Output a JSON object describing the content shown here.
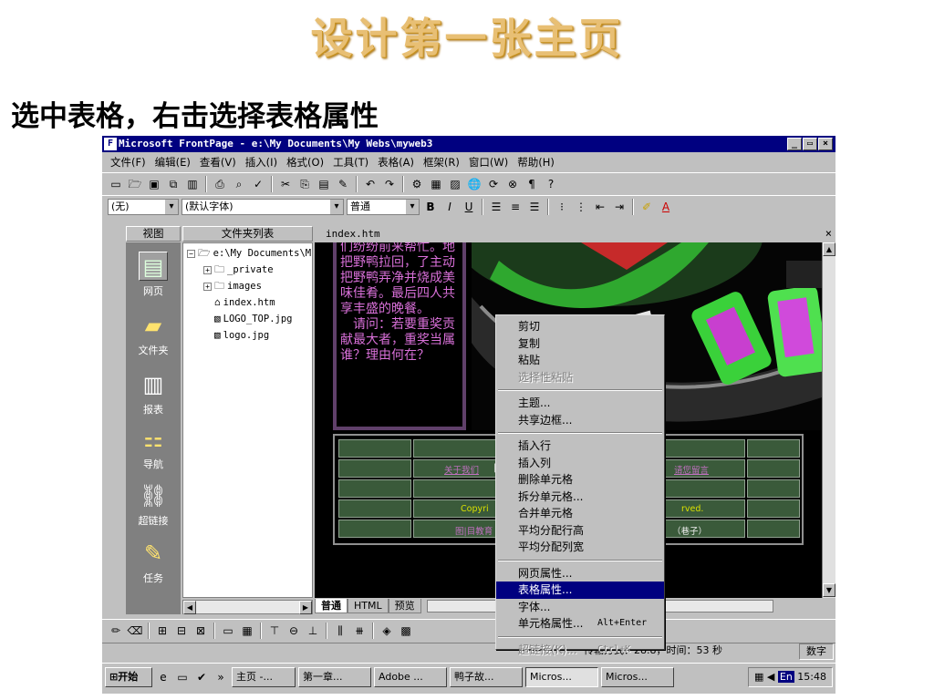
{
  "slide": {
    "title": "设计第一张主页",
    "subtitle": "选中表格，右击选择表格属性"
  },
  "window": {
    "title": "Microsoft FrontPage - e:\\My Documents\\My Webs\\myweb3",
    "controls": [
      "_",
      "▭",
      "×"
    ]
  },
  "menu": [
    "文件(F)",
    "编辑(E)",
    "查看(V)",
    "插入(I)",
    "格式(O)",
    "工具(T)",
    "表格(A)",
    "框架(R)",
    "窗口(W)",
    "帮助(H)"
  ],
  "format_toolbar": {
    "style": "(无)",
    "font": "(默认字体)",
    "size": "普通",
    "bold": "B",
    "italic": "I",
    "underline": "U"
  },
  "views": {
    "header": "视图",
    "items": [
      {
        "label": "网页",
        "icon": "page-icon"
      },
      {
        "label": "文件夹",
        "icon": "folder-icon"
      },
      {
        "label": "报表",
        "icon": "reports-icon"
      },
      {
        "label": "导航",
        "icon": "navigation-icon"
      },
      {
        "label": "超链接",
        "icon": "hyperlinks-icon"
      },
      {
        "label": "任务",
        "icon": "tasks-icon"
      }
    ]
  },
  "folder_list": {
    "header": "文件夹列表",
    "root": "e:\\My Documents\\M",
    "items": [
      "_private",
      "images",
      "index.htm",
      "LOGO_TOP.jpg",
      "logo.jpg"
    ]
  },
  "editor": {
    "tab": "index.htm",
    "close": "×",
    "story_text": "来到小鸟家后，邻居们纷纷前来帮忙。地把野鸭拉回，了主动把野鸭弄净并烧成美味佳肴。最后四人共享丰盛的晚餐。\n　请问：若要重奖贡献最大者，重奖当属谁？理由何在？",
    "nav_links": [
      "关于我们",
      "|",
      "请您留言"
    ],
    "copyright_left": "Copyri",
    "copyright_right": "rved.",
    "footer_left": "图|目教育",
    "footer_right": "（巷子）",
    "view_tabs": [
      "普通",
      "HTML",
      "预览"
    ]
  },
  "context_menu": {
    "items": [
      {
        "label": "剪切",
        "disabled": false
      },
      {
        "label": "复制",
        "disabled": false
      },
      {
        "label": "粘贴",
        "disabled": false
      },
      {
        "label": "选择性粘贴",
        "disabled": true
      },
      {
        "sep": true
      },
      {
        "label": "主题...",
        "disabled": false
      },
      {
        "label": "共享边框...",
        "disabled": false
      },
      {
        "sep": true
      },
      {
        "label": "插入行",
        "disabled": false
      },
      {
        "label": "插入列",
        "disabled": false
      },
      {
        "label": "删除单元格",
        "disabled": false
      },
      {
        "label": "拆分单元格...",
        "disabled": false
      },
      {
        "label": "合并单元格",
        "disabled": false
      },
      {
        "label": "平均分配行高",
        "disabled": false
      },
      {
        "label": "平均分配列宽",
        "disabled": false
      },
      {
        "sep": true
      },
      {
        "label": "网页属性...",
        "disabled": false
      },
      {
        "label": "表格属性...",
        "disabled": false,
        "selected": true
      },
      {
        "label": "字体...",
        "disabled": false
      },
      {
        "label": "单元格属性...",
        "accel": "Alt+Enter",
        "disabled": false
      },
      {
        "sep": true
      },
      {
        "label": "超链接(K)...",
        "accel": "Ctrl+K",
        "disabled": true
      }
    ]
  },
  "status": {
    "connection": "传输方式：28.8，时间：53 秒",
    "mode": "数字"
  },
  "taskbar": {
    "start": "开始",
    "tasks": [
      "主页 -...",
      "第一章...",
      "Adobe ...",
      "鸭子故...",
      "Micros...",
      "Micros..."
    ],
    "tray_lang": "En",
    "clock": "15:48"
  },
  "colors": {
    "title_gold": "#e8bf74",
    "titlebar": "#000080",
    "story_text": "#d970d9",
    "menu_highlight": "#000080"
  }
}
